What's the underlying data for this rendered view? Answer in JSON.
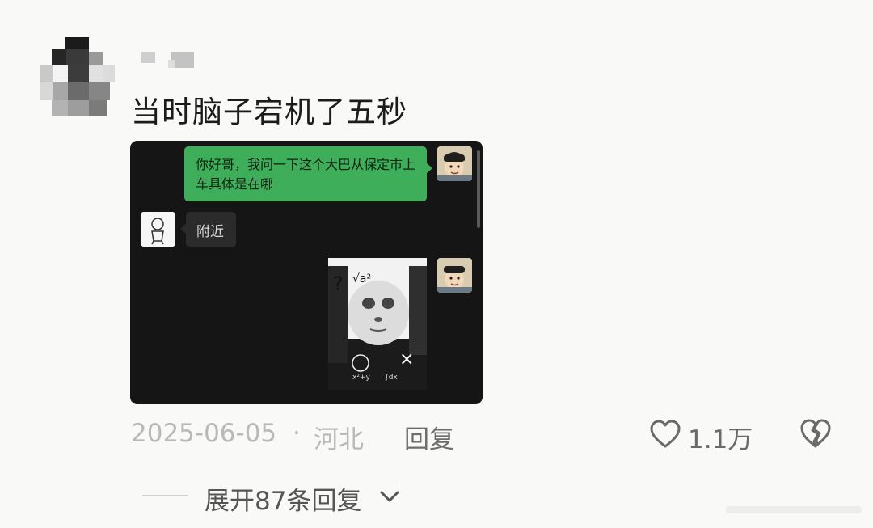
{
  "comment": {
    "text": "当时脑子宕机了五秒",
    "date": "2025-06-05",
    "separator": "·",
    "location": "河北",
    "reply_label": "回复",
    "like_count": "1.1万",
    "expand_label": "展开87条回复"
  },
  "chat_screenshot": {
    "messages": [
      {
        "side": "right",
        "type": "text",
        "text": "你好哥，我问一下这个大巴从保定市上车具体是在哪"
      },
      {
        "side": "left",
        "type": "text",
        "text": "附近"
      },
      {
        "side": "right",
        "type": "sticker",
        "sticker": "panda-meme-sticker"
      }
    ],
    "colors": {
      "background": "#151515",
      "sent_bubble": "#3fae5a",
      "received_bubble": "#2b2b2b"
    }
  },
  "icons": {
    "like": "heart-outline-icon",
    "dislike": "broken-heart-icon",
    "expand": "chevron-down-icon"
  }
}
